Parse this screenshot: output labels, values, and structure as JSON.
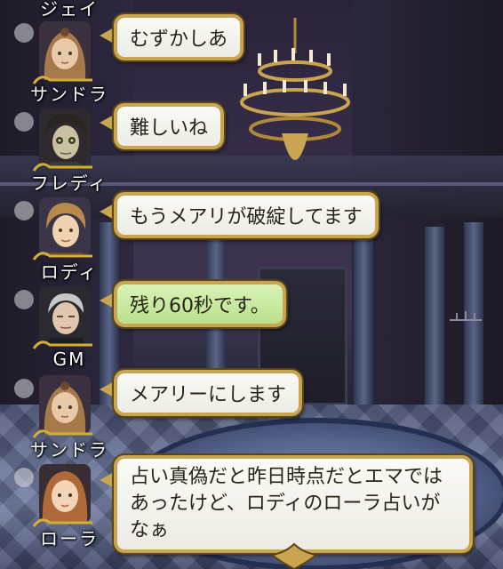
{
  "chat": [
    {
      "name": "ジェイ",
      "text": ""
    },
    {
      "name": "サンドラ",
      "text": "むずかしあ"
    },
    {
      "name": "フレディ",
      "text": "難しいね"
    },
    {
      "name": "ロディ",
      "text": "もうメアリが破綻してます"
    },
    {
      "name": "GM",
      "text": "残り60秒です。",
      "highlight": true
    },
    {
      "name": "サンドラ",
      "text": "メアリーにします"
    },
    {
      "name": "ローラ",
      "text": "占い真偽だと昨日時点だとエマではあったけど、ロディのローラ占いがなぁ"
    }
  ],
  "colors": {
    "bubble": "#f5f4ee",
    "bubble_gm": "#c9eaa0",
    "bubble_border": "#c9a451",
    "name_text": "#ffffff"
  },
  "icons": [
    "chandelier-icon",
    "ornament-frame-icon",
    "crest-icon"
  ]
}
